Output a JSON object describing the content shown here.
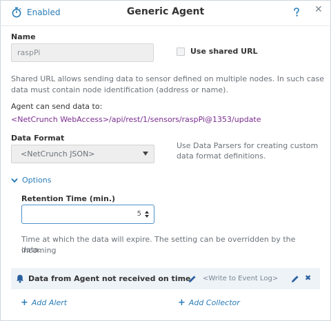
{
  "header": {
    "status_label": "Enabled",
    "title": "Generic Agent",
    "close_glyph": "✕"
  },
  "name": {
    "label": "Name",
    "value": "raspPi"
  },
  "shared_url": {
    "label": "Use shared URL",
    "checked": false,
    "description_line1": "Shared URL allows sending data to sensor defined on multiple nodes. In such case",
    "description_line2": "data must contain node identification (address or name)."
  },
  "agent_url": {
    "label": "Agent can send data to:",
    "host": "<NetCrunch WebAccess>",
    "path": "/api/rest/1/sensors/raspPi@1353/update"
  },
  "data_format": {
    "label": "Data Format",
    "selected": "<NetCrunch JSON>",
    "hint_line1": "Use Data Parsers for creating custom",
    "hint_line2": "data format definitions."
  },
  "options": {
    "label": "Options"
  },
  "retention": {
    "label": "Retention Time (min.)",
    "value": "5",
    "description_line1": "Time at which the data will expire. The setting can be overridden by the incoming",
    "description_line2": "data."
  },
  "alert": {
    "condition": "Data from Agent not received on time",
    "action": "<Write to Event Log>",
    "remove_glyph": "✖"
  },
  "footer": {
    "add_alert": "Add Alert",
    "add_collector": "Add Collector",
    "plus_glyph": "+"
  },
  "colors": {
    "accent": "#2a7db8",
    "link_purple": "#7a2c8e",
    "alert_bg": "#eef3f8",
    "focus_border": "#4a90c8"
  },
  "icons": [
    "stopwatch-icon",
    "help-icon",
    "close-icon",
    "chevron-down-icon",
    "bell-icon",
    "pencil-icon",
    "remove-icon",
    "plus-icon"
  ]
}
